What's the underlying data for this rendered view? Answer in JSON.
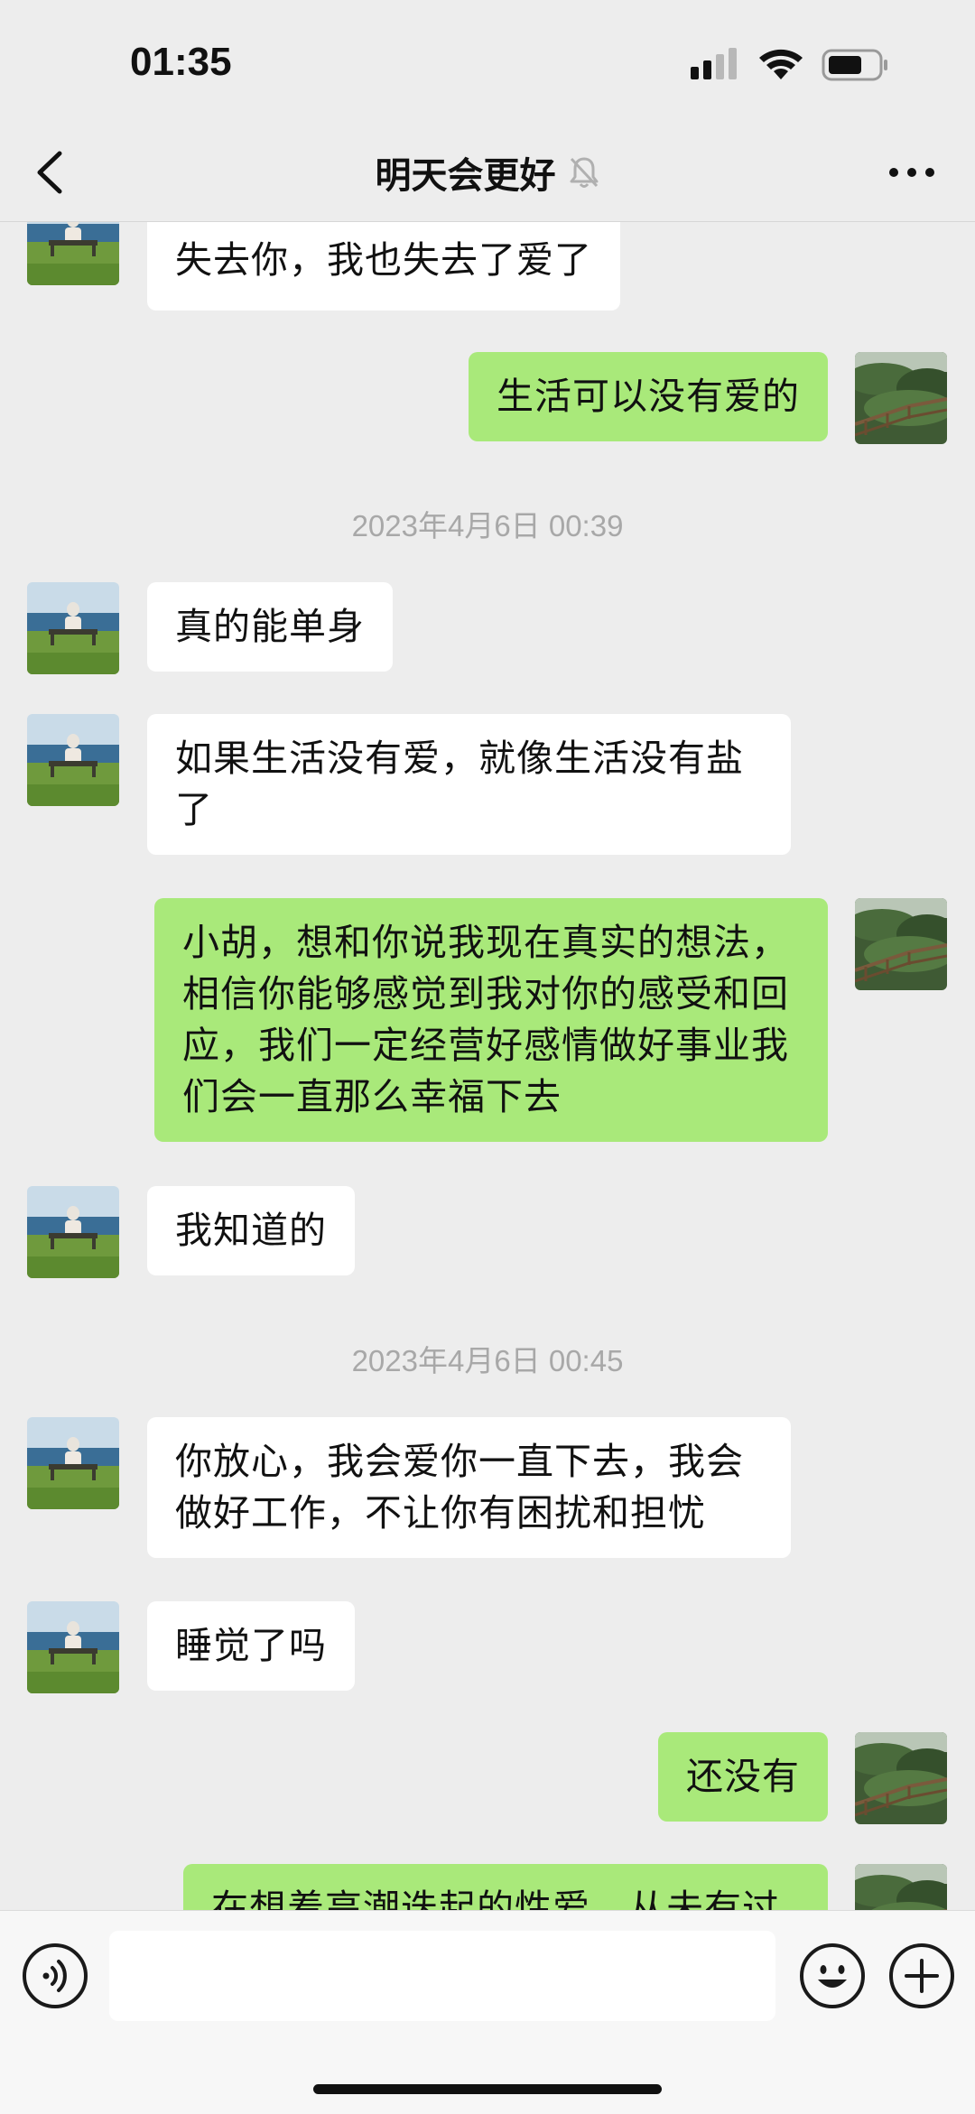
{
  "status_bar": {
    "time": "01:35"
  },
  "header": {
    "title": "明天会更好",
    "back_icon": "chevron-left-icon",
    "mute_icon": "bell-muted-icon",
    "more_icon": "more-dots-icon"
  },
  "timestamps": [
    "2023年4月6日 00:39",
    "2023年4月6日 00:45"
  ],
  "messages": [
    {
      "side": "in",
      "text": "失去你，我也失去了爱了"
    },
    {
      "side": "out",
      "text": "生活可以没有爱的"
    },
    {
      "side": "in",
      "text": "真的能单身"
    },
    {
      "side": "in",
      "text": "如果生活没有爱，就像生活没有盐了"
    },
    {
      "side": "out",
      "text": "小胡，想和你说我现在真实的想法，相信你能够感觉到我对你的感受和回应，我们一定经营好感情做好事业我们会一直那么幸福下去"
    },
    {
      "side": "in",
      "text": "我知道的"
    },
    {
      "side": "in",
      "text": "你放心，我会爱你一直下去，我会做好工作，不让你有困扰和担忧"
    },
    {
      "side": "in",
      "text": "睡觉了吗"
    },
    {
      "side": "out",
      "text": "还没有"
    },
    {
      "side": "out",
      "text": "在想着高潮迭起的性爱，从未有过"
    }
  ],
  "input_bar": {
    "voice_icon": "voice-icon",
    "emoji_icon": "emoji-icon",
    "plus_icon": "plus-icon",
    "input_value": ""
  },
  "colors": {
    "background": "#ededed",
    "outgoing_bubble": "#a9e97a",
    "incoming_bubble": "#ffffff",
    "timestamp": "#a8a8a8"
  }
}
